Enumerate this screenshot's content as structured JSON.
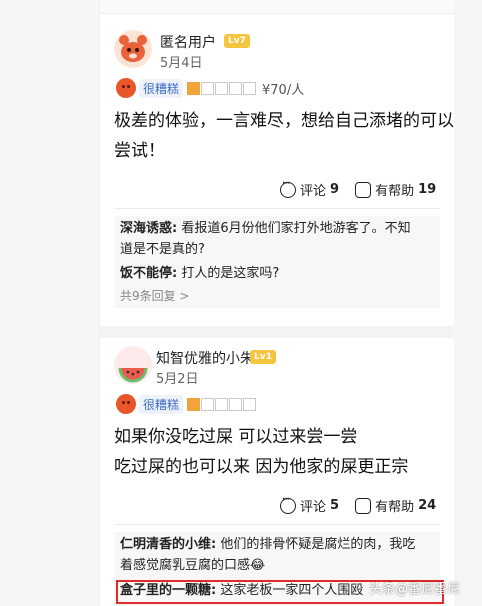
{
  "reviews": [
    {
      "username": "匿名用户",
      "level": "Lv7",
      "date": "5月4日",
      "rating_label": "很糟糕",
      "stars_filled": 1,
      "stars_total": 5,
      "price": "¥70/人",
      "content_lines": [
        "极差的体验，一言难尽，想给自己添堵的可以",
        "尝试！"
      ],
      "comments_label": "评论",
      "comments_count": "9",
      "helpful_label": "有帮助",
      "helpful_count": "19",
      "replies": [
        {
          "user": "深海诱惑:",
          "text_lines": [
            "看报道6月份他们家打外地游客了。不知",
            "道是不是真的?"
          ]
        },
        {
          "user": "饭不能停:",
          "text_lines": [
            "打人的是这家吗?"
          ]
        }
      ],
      "more_replies": "共9条回复 >"
    },
    {
      "username": "知智优雅的小朱",
      "level": "Lv1",
      "date": "5月2日",
      "rating_label": "很糟糕",
      "stars_filled": 1,
      "stars_total": 5,
      "content_lines": [
        "如果你没吃过屎 可以过来尝一尝",
        "吃过屎的也可以来 因为他家的屎更正宗"
      ],
      "comments_label": "评论",
      "comments_count": "5",
      "helpful_label": "有帮助",
      "helpful_count": "24",
      "replies": [
        {
          "user": "仁明清香的小维:",
          "text_lines": [
            "他们的排骨怀疑是腐烂的肉，我吃",
            "着感觉腐乳豆腐的口感😂"
          ]
        },
        {
          "user": "盒子里的一颗糖:",
          "text_lines": [
            "这家老板一家四个人围殴"
          ]
        }
      ]
    }
  ],
  "watermark": "头条@番尼番尼"
}
